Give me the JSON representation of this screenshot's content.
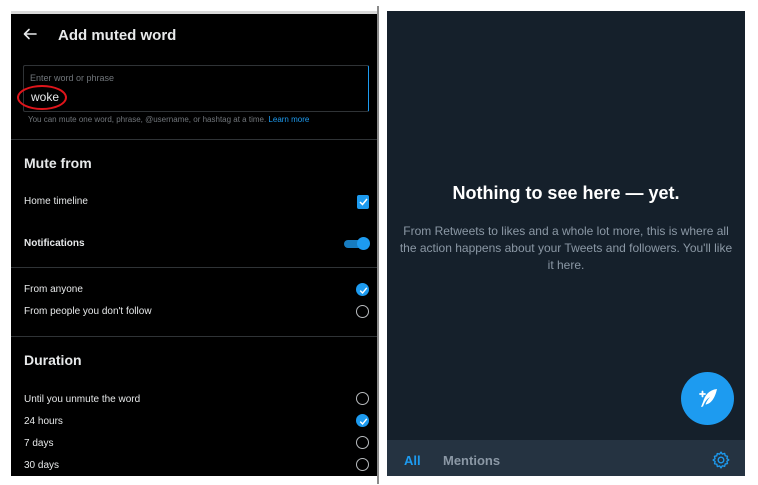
{
  "left": {
    "header": {
      "title": "Add muted word"
    },
    "word_input": {
      "placeholder": "Enter word or phrase",
      "value": "woke",
      "help_text": "You can mute one word, phrase, @username, or hashtag at a time.",
      "learn_more": "Learn more"
    },
    "mute_from": {
      "title": "Mute from",
      "home_timeline": {
        "label": "Home timeline",
        "checked": true
      },
      "notifications": {
        "label": "Notifications",
        "enabled": true
      },
      "from_anyone": {
        "label": "From anyone",
        "selected": true
      },
      "from_not_following": {
        "label": "From people you don't follow",
        "selected": false
      }
    },
    "duration": {
      "title": "Duration",
      "options": [
        {
          "label": "Until you unmute the word",
          "selected": false
        },
        {
          "label": "24 hours",
          "selected": true
        },
        {
          "label": "7 days",
          "selected": false
        },
        {
          "label": "30 days",
          "selected": false
        }
      ]
    }
  },
  "right": {
    "empty_state": {
      "title": "Nothing to see here — yet.",
      "body": "From Retweets to likes and a whole lot more, this is where all the action happens about your Tweets and followers. You'll like it here."
    },
    "tabs": {
      "all": "All",
      "mentions": "Mentions"
    },
    "icons": {
      "compose": "compose-tweet-icon",
      "settings": "gear-icon"
    }
  },
  "colors": {
    "accent": "#1d9bf0",
    "left_background": "#000000",
    "right_background": "#15202b",
    "annotation_circle": "#e0151b"
  }
}
